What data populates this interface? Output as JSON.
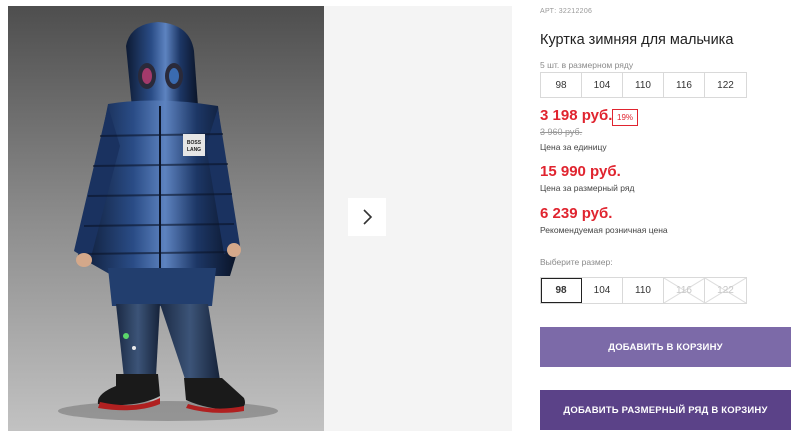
{
  "product": {
    "article": "АРТ: 32212206",
    "title": "Куртка зимняя для мальчика",
    "pack_label": "5 шт. в размерном ряду",
    "pack_sizes": [
      "98",
      "104",
      "110",
      "116",
      "122"
    ],
    "price": "3 198 руб.",
    "discount": "19%",
    "old_price": "3 960 руб.",
    "price_unit_label": "Цена за единицу",
    "row_price": "15 990 руб.",
    "row_price_label": "Цена за размерный ряд",
    "rrp_price": "6 239 руб.",
    "rrp_label": "Рекомендуемая розничная цена",
    "choose_size_label": "Выберите размер:",
    "choose_sizes": [
      {
        "label": "98",
        "state": "selected"
      },
      {
        "label": "104",
        "state": "available"
      },
      {
        "label": "110",
        "state": "available"
      },
      {
        "label": "116",
        "state": "disabled"
      },
      {
        "label": "122",
        "state": "disabled"
      }
    ],
    "add_to_cart": "ДОБАВИТЬ В КОРЗИНУ",
    "add_row_to_cart": "ДОБАВИТЬ РАЗМЕРНЫЙ РЯД В КОРЗИНУ"
  },
  "gallery": {
    "next_icon": "chevron-right-icon",
    "photo_text": "BOSS LANG"
  },
  "colors": {
    "price_red": "#e0242f",
    "button_light": "#7c6aa8",
    "button_dark": "#5b4288"
  }
}
